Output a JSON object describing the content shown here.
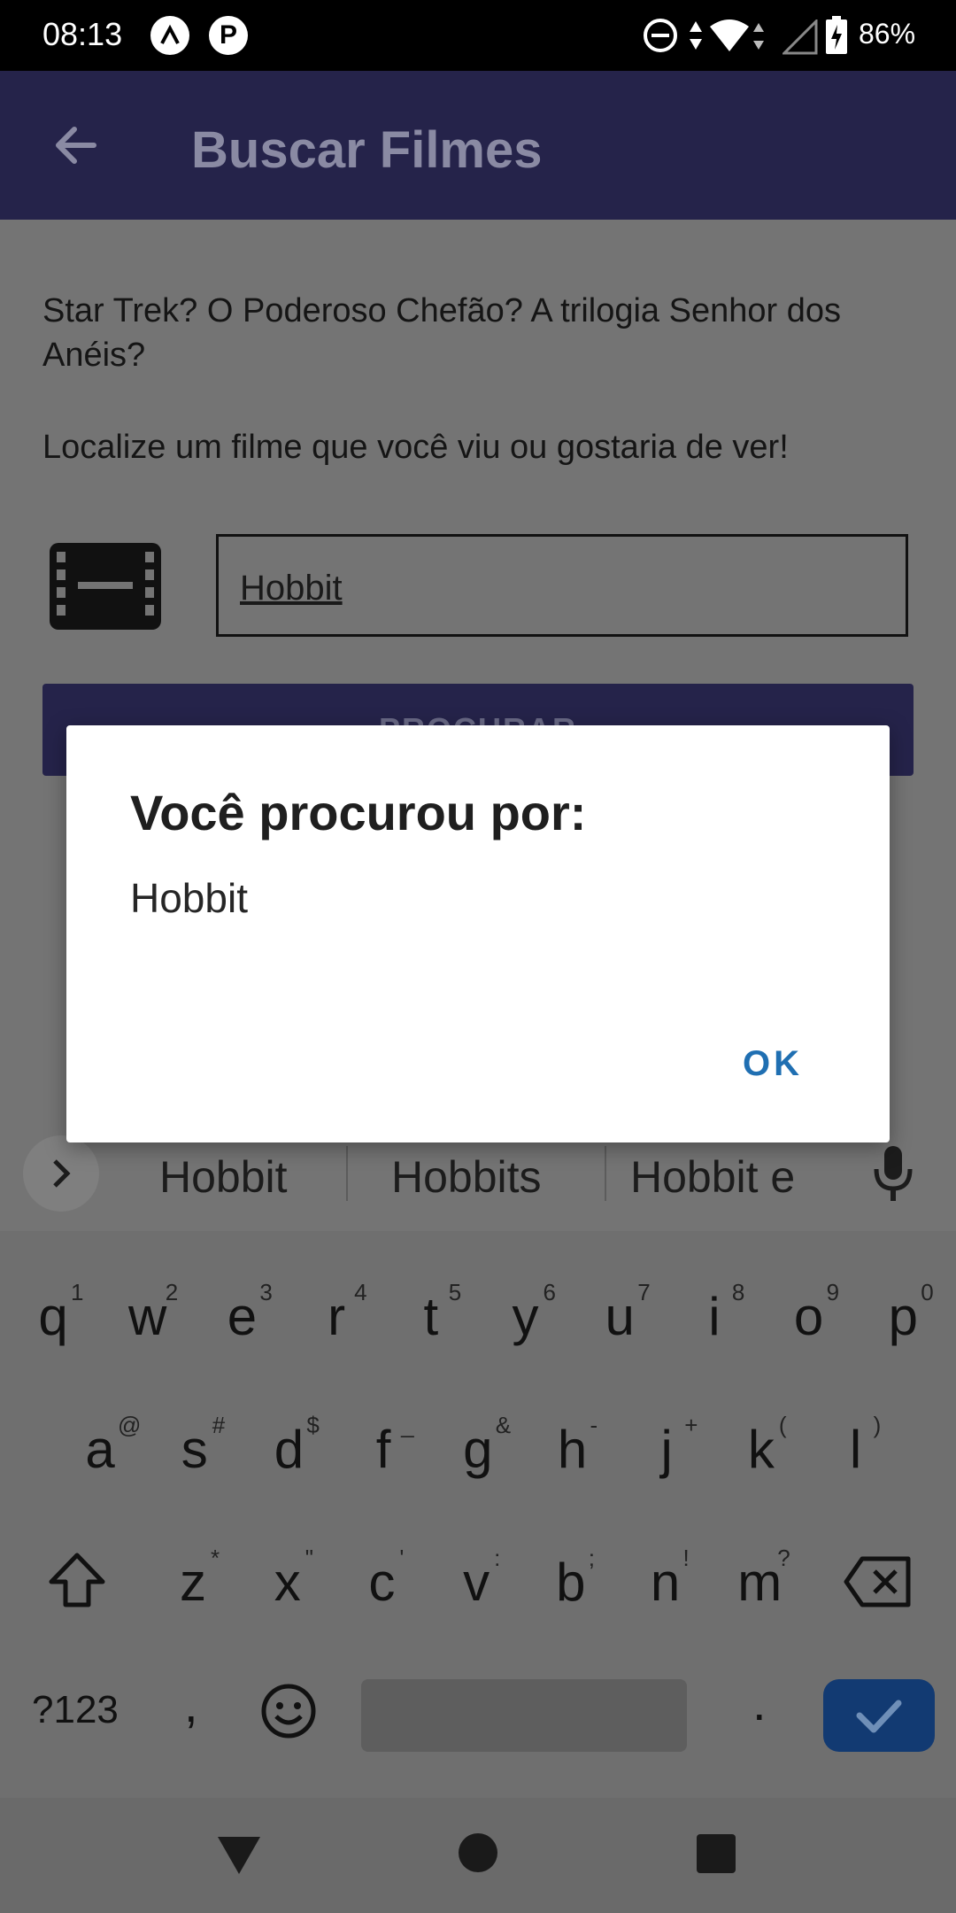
{
  "status_bar": {
    "time": "08:13",
    "battery_percent": "86%",
    "notif_icons": [
      "arrow-up-logo-icon",
      "p-logo-icon"
    ]
  },
  "app_bar": {
    "title": "Buscar Filmes"
  },
  "content": {
    "intro": "Star Trek? O Poderoso Chefão? A trilogia Senhor dos Anéis?",
    "prompt": "Localize um filme que você viu ou gostaria de ver!",
    "search_value": "Hobbit",
    "search_button_label": "PROCURAR"
  },
  "dialog": {
    "title": "Você procurou por:",
    "message": "Hobbit",
    "ok_label": "OK"
  },
  "suggestions": [
    "Hobbit",
    "Hobbits",
    "Hobbit e"
  ],
  "keyboard": {
    "row1": [
      {
        "k": "q",
        "s": "1"
      },
      {
        "k": "w",
        "s": "2"
      },
      {
        "k": "e",
        "s": "3"
      },
      {
        "k": "r",
        "s": "4"
      },
      {
        "k": "t",
        "s": "5"
      },
      {
        "k": "y",
        "s": "6"
      },
      {
        "k": "u",
        "s": "7"
      },
      {
        "k": "i",
        "s": "8"
      },
      {
        "k": "o",
        "s": "9"
      },
      {
        "k": "p",
        "s": "0"
      }
    ],
    "row2": [
      {
        "k": "a",
        "s": "@"
      },
      {
        "k": "s",
        "s": "#"
      },
      {
        "k": "d",
        "s": "$"
      },
      {
        "k": "f",
        "s": "_"
      },
      {
        "k": "g",
        "s": "&"
      },
      {
        "k": "h",
        "s": "-"
      },
      {
        "k": "j",
        "s": "+"
      },
      {
        "k": "k",
        "s": "("
      },
      {
        "k": "l",
        "s": ")"
      }
    ],
    "row3": [
      {
        "k": "z",
        "s": "*"
      },
      {
        "k": "x",
        "s": "\""
      },
      {
        "k": "c",
        "s": "'"
      },
      {
        "k": "v",
        "s": ":"
      },
      {
        "k": "b",
        "s": ";"
      },
      {
        "k": "n",
        "s": "!"
      },
      {
        "k": "m",
        "s": "?"
      }
    ],
    "symbols_label": "?123",
    "comma": ",",
    "period": "."
  },
  "colors": {
    "app_bar": "#25234a",
    "dialog_button": "#1f6fb2",
    "enter_key": "#123a72"
  }
}
